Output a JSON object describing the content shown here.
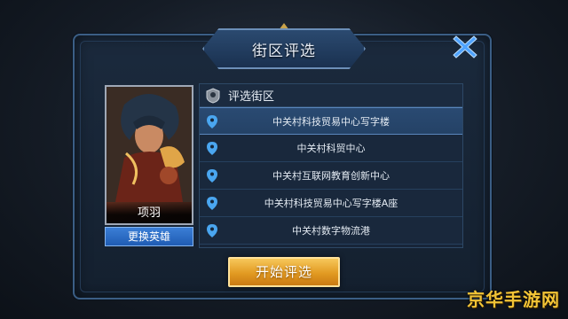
{
  "dialog": {
    "title": "街区评选",
    "close_icon": "close-icon"
  },
  "hero": {
    "name": "项羽",
    "change_button": "更换英雄"
  },
  "district_list": {
    "header_icon": "badge-icon",
    "header": "评选街区",
    "item_icon": "location-pin-icon",
    "items": [
      {
        "label": "中关村科技贸易中心写字楼",
        "selected": true
      },
      {
        "label": "中关村科贸中心",
        "selected": false
      },
      {
        "label": "中关村互联网教育创新中心",
        "selected": false
      },
      {
        "label": "中关村科技贸易中心写字楼A座",
        "selected": false
      },
      {
        "label": "中关村数字物流港",
        "selected": false
      }
    ]
  },
  "actions": {
    "start_button": "开始评选"
  },
  "watermark": "京华手游网",
  "colors": {
    "accent_blue": "#3b7ed6",
    "start_gold": "#e29a22",
    "close_blue": "#4fa3ff",
    "pin_blue": "#4aa6f0"
  }
}
